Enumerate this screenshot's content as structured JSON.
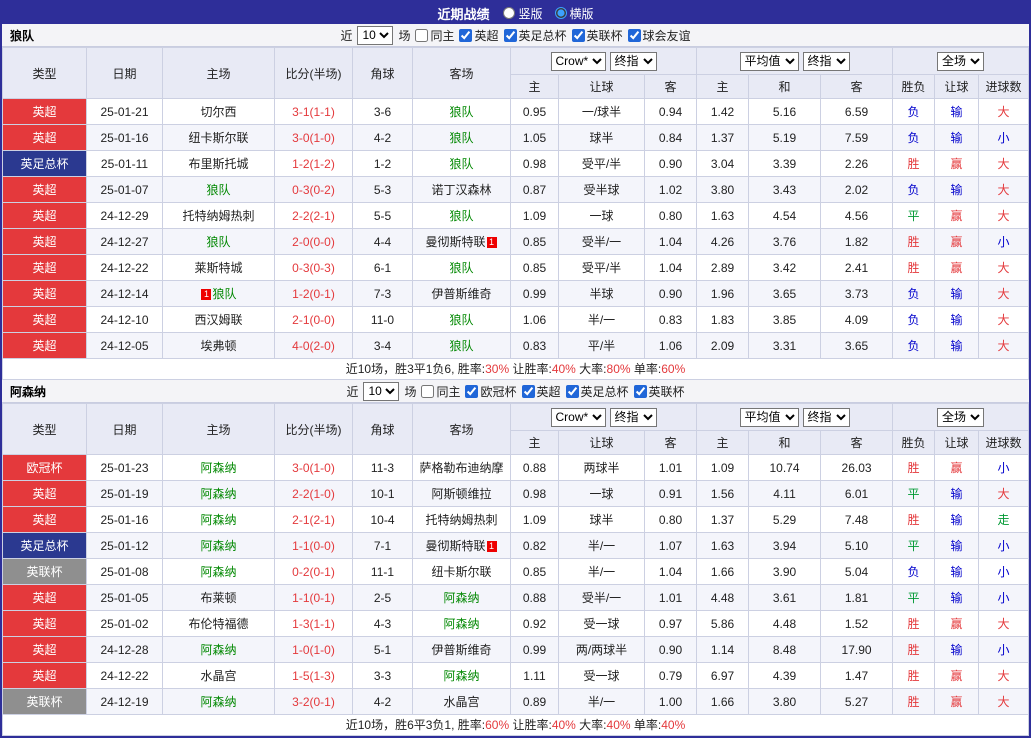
{
  "topbar": {
    "title": "近期战绩",
    "radios": [
      {
        "label": "竖版",
        "selected": false
      },
      {
        "label": "横版",
        "selected": true
      }
    ]
  },
  "colors": {
    "bar": "#2e2e99",
    "subject_team": "#008800",
    "score": "#e4393c",
    "league": {
      "epl": "#e4393c",
      "facup": "#2b3990",
      "eflcup": "#8f8f8f",
      "ucl": "#e4393c"
    },
    "result": {
      "win": "#e4393c",
      "draw": "#009933",
      "lose": "#0000cc",
      "plain": "#222222"
    }
  },
  "filter_labels": {
    "near": "近",
    "games": "场",
    "same_home": "同主"
  },
  "table_header": {
    "type": "类型",
    "date": "日期",
    "home": "主场",
    "score": "比分(半场)",
    "corner": "角球",
    "away": "客场",
    "bookmaker_select": "Crow*",
    "final_select": "终指",
    "average_select": "平均值",
    "fullmatch_select": "全场",
    "sub": [
      "主",
      "让球",
      "客",
      "主",
      "和",
      "客",
      "胜负",
      "让球",
      "进球数"
    ]
  },
  "sections": [
    {
      "team": "狼队",
      "count": "10",
      "same_home_checked": false,
      "leagues": [
        {
          "label": "英超",
          "checked": true
        },
        {
          "label": "英足总杯",
          "checked": true
        },
        {
          "label": "英联杯",
          "checked": true
        },
        {
          "label": "球会友谊",
          "checked": true
        }
      ],
      "rows": [
        {
          "lg": "英超",
          "lk": "epl",
          "date": "25-01-21",
          "home": {
            "n": "切尔西"
          },
          "score": "3-1(1-1)",
          "corner": "3-6",
          "away": {
            "n": "狼队",
            "s": 1
          },
          "asian": [
            "0.95",
            "一/球半",
            "0.94"
          ],
          "euro": [
            "1.42",
            "5.16",
            "6.59"
          ],
          "res": [
            [
              "负",
              "lose"
            ],
            [
              "输",
              "lose"
            ],
            [
              "大",
              "win"
            ]
          ]
        },
        {
          "lg": "英超",
          "lk": "epl",
          "date": "25-01-16",
          "home": {
            "n": "纽卡斯尔联"
          },
          "score": "3-0(1-0)",
          "corner": "4-2",
          "away": {
            "n": "狼队",
            "s": 1
          },
          "asian": [
            "1.05",
            "球半",
            "0.84"
          ],
          "euro": [
            "1.37",
            "5.19",
            "7.59"
          ],
          "res": [
            [
              "负",
              "lose"
            ],
            [
              "输",
              "lose"
            ],
            [
              "小",
              "lose"
            ]
          ]
        },
        {
          "lg": "英足总杯",
          "lk": "facup",
          "date": "25-01-11",
          "home": {
            "n": "布里斯托城"
          },
          "score": "1-2(1-2)",
          "corner": "1-2",
          "away": {
            "n": "狼队",
            "s": 1
          },
          "asian": [
            "0.98",
            "受平/半",
            "0.90"
          ],
          "euro": [
            "3.04",
            "3.39",
            "2.26"
          ],
          "res": [
            [
              "胜",
              "win"
            ],
            [
              "赢",
              "win"
            ],
            [
              "大",
              "win"
            ]
          ]
        },
        {
          "lg": "英超",
          "lk": "epl",
          "date": "25-01-07",
          "home": {
            "n": "狼队",
            "s": 1
          },
          "score": "0-3(0-2)",
          "corner": "5-3",
          "away": {
            "n": "诺丁汉森林"
          },
          "asian": [
            "0.87",
            "受半球",
            "1.02"
          ],
          "euro": [
            "3.80",
            "3.43",
            "2.02"
          ],
          "res": [
            [
              "负",
              "lose"
            ],
            [
              "输",
              "lose"
            ],
            [
              "大",
              "win"
            ]
          ]
        },
        {
          "lg": "英超",
          "lk": "epl",
          "date": "24-12-29",
          "home": {
            "n": "托特纳姆热刺"
          },
          "score": "2-2(2-1)",
          "corner": "5-5",
          "away": {
            "n": "狼队",
            "s": 1
          },
          "asian": [
            "1.09",
            "一球",
            "0.80"
          ],
          "euro": [
            "1.63",
            "4.54",
            "4.56"
          ],
          "res": [
            [
              "平",
              "draw"
            ],
            [
              "赢",
              "win"
            ],
            [
              "大",
              "win"
            ]
          ]
        },
        {
          "lg": "英超",
          "lk": "epl",
          "date": "24-12-27",
          "home": {
            "n": "狼队",
            "s": 1
          },
          "score": "2-0(0-0)",
          "corner": "4-4",
          "away": {
            "n": "曼彻斯特联",
            "b": "1",
            "bp": "after"
          },
          "asian": [
            "0.85",
            "受半/一",
            "1.04"
          ],
          "euro": [
            "4.26",
            "3.76",
            "1.82"
          ],
          "res": [
            [
              "胜",
              "win"
            ],
            [
              "赢",
              "win"
            ],
            [
              "小",
              "lose"
            ]
          ]
        },
        {
          "lg": "英超",
          "lk": "epl",
          "date": "24-12-22",
          "home": {
            "n": "莱斯特城"
          },
          "score": "0-3(0-3)",
          "corner": "6-1",
          "away": {
            "n": "狼队",
            "s": 1
          },
          "asian": [
            "0.85",
            "受平/半",
            "1.04"
          ],
          "euro": [
            "2.89",
            "3.42",
            "2.41"
          ],
          "res": [
            [
              "胜",
              "win"
            ],
            [
              "赢",
              "win"
            ],
            [
              "大",
              "win"
            ]
          ]
        },
        {
          "lg": "英超",
          "lk": "epl",
          "date": "24-12-14",
          "home": {
            "n": "狼队",
            "s": 1,
            "b": "1",
            "bp": "before"
          },
          "score": "1-2(0-1)",
          "corner": "7-3",
          "away": {
            "n": "伊普斯维奇"
          },
          "asian": [
            "0.99",
            "半球",
            "0.90"
          ],
          "euro": [
            "1.96",
            "3.65",
            "3.73"
          ],
          "res": [
            [
              "负",
              "lose"
            ],
            [
              "输",
              "lose"
            ],
            [
              "大",
              "win"
            ]
          ]
        },
        {
          "lg": "英超",
          "lk": "epl",
          "date": "24-12-10",
          "home": {
            "n": "西汉姆联"
          },
          "score": "2-1(0-0)",
          "corner": "11-0",
          "away": {
            "n": "狼队",
            "s": 1
          },
          "asian": [
            "1.06",
            "半/一",
            "0.83"
          ],
          "euro": [
            "1.83",
            "3.85",
            "4.09"
          ],
          "res": [
            [
              "负",
              "lose"
            ],
            [
              "输",
              "lose"
            ],
            [
              "大",
              "win"
            ]
          ]
        },
        {
          "lg": "英超",
          "lk": "epl",
          "date": "24-12-05",
          "home": {
            "n": "埃弗顿"
          },
          "score": "4-0(2-0)",
          "corner": "3-4",
          "away": {
            "n": "狼队",
            "s": 1
          },
          "asian": [
            "0.83",
            "平/半",
            "1.06"
          ],
          "euro": [
            "2.09",
            "3.31",
            "3.65"
          ],
          "res": [
            [
              "负",
              "lose"
            ],
            [
              "输",
              "lose"
            ],
            [
              "大",
              "win"
            ]
          ]
        }
      ],
      "summary": [
        {
          "t": "近10场，胜3平1负6, 胜率:",
          "k": "plain"
        },
        {
          "t": "30%",
          "k": "win"
        },
        {
          "t": " 让胜率:",
          "k": "plain"
        },
        {
          "t": "40%",
          "k": "win"
        },
        {
          "t": " 大率:",
          "k": "plain"
        },
        {
          "t": "80%",
          "k": "win"
        },
        {
          "t": " 单率:",
          "k": "plain"
        },
        {
          "t": "60%",
          "k": "win"
        }
      ]
    },
    {
      "team": "阿森纳",
      "count": "10",
      "same_home_checked": false,
      "leagues": [
        {
          "label": "欧冠杯",
          "checked": true
        },
        {
          "label": "英超",
          "checked": true
        },
        {
          "label": "英足总杯",
          "checked": true
        },
        {
          "label": "英联杯",
          "checked": true
        }
      ],
      "rows": [
        {
          "lg": "欧冠杯",
          "lk": "ucl",
          "date": "25-01-23",
          "home": {
            "n": "阿森纳",
            "s": 1
          },
          "score": "3-0(1-0)",
          "corner": "11-3",
          "away": {
            "n": "萨格勒布迪纳摩"
          },
          "asian": [
            "0.88",
            "两球半",
            "1.01"
          ],
          "euro": [
            "1.09",
            "10.74",
            "26.03"
          ],
          "res": [
            [
              "胜",
              "win"
            ],
            [
              "赢",
              "win"
            ],
            [
              "小",
              "lose"
            ]
          ]
        },
        {
          "lg": "英超",
          "lk": "epl",
          "date": "25-01-19",
          "home": {
            "n": "阿森纳",
            "s": 1
          },
          "score": "2-2(1-0)",
          "corner": "10-1",
          "away": {
            "n": "阿斯顿维拉"
          },
          "asian": [
            "0.98",
            "一球",
            "0.91"
          ],
          "euro": [
            "1.56",
            "4.11",
            "6.01"
          ],
          "res": [
            [
              "平",
              "draw"
            ],
            [
              "输",
              "lose"
            ],
            [
              "大",
              "win"
            ]
          ]
        },
        {
          "lg": "英超",
          "lk": "epl",
          "date": "25-01-16",
          "home": {
            "n": "阿森纳",
            "s": 1
          },
          "score": "2-1(2-1)",
          "corner": "10-4",
          "away": {
            "n": "托特纳姆热刺"
          },
          "asian": [
            "1.09",
            "球半",
            "0.80"
          ],
          "euro": [
            "1.37",
            "5.29",
            "7.48"
          ],
          "res": [
            [
              "胜",
              "win"
            ],
            [
              "输",
              "lose"
            ],
            [
              "走",
              "draw"
            ]
          ]
        },
        {
          "lg": "英足总杯",
          "lk": "facup",
          "date": "25-01-12",
          "home": {
            "n": "阿森纳",
            "s": 1
          },
          "score": "1-1(0-0)",
          "corner": "7-1",
          "away": {
            "n": "曼彻斯特联",
            "b": "1",
            "bp": "after"
          },
          "asian": [
            "0.82",
            "半/一",
            "1.07"
          ],
          "euro": [
            "1.63",
            "3.94",
            "5.10"
          ],
          "res": [
            [
              "平",
              "draw"
            ],
            [
              "输",
              "lose"
            ],
            [
              "小",
              "lose"
            ]
          ]
        },
        {
          "lg": "英联杯",
          "lk": "eflcup",
          "date": "25-01-08",
          "home": {
            "n": "阿森纳",
            "s": 1
          },
          "score": "0-2(0-1)",
          "corner": "11-1",
          "away": {
            "n": "纽卡斯尔联"
          },
          "asian": [
            "0.85",
            "半/一",
            "1.04"
          ],
          "euro": [
            "1.66",
            "3.90",
            "5.04"
          ],
          "res": [
            [
              "负",
              "lose"
            ],
            [
              "输",
              "lose"
            ],
            [
              "小",
              "lose"
            ]
          ]
        },
        {
          "lg": "英超",
          "lk": "epl",
          "date": "25-01-05",
          "home": {
            "n": "布莱顿"
          },
          "score": "1-1(0-1)",
          "corner": "2-5",
          "away": {
            "n": "阿森纳",
            "s": 1
          },
          "asian": [
            "0.88",
            "受半/一",
            "1.01"
          ],
          "euro": [
            "4.48",
            "3.61",
            "1.81"
          ],
          "res": [
            [
              "平",
              "draw"
            ],
            [
              "输",
              "lose"
            ],
            [
              "小",
              "lose"
            ]
          ]
        },
        {
          "lg": "英超",
          "lk": "epl",
          "date": "25-01-02",
          "home": {
            "n": "布伦特福德"
          },
          "score": "1-3(1-1)",
          "corner": "4-3",
          "away": {
            "n": "阿森纳",
            "s": 1
          },
          "asian": [
            "0.92",
            "受一球",
            "0.97"
          ],
          "euro": [
            "5.86",
            "4.48",
            "1.52"
          ],
          "res": [
            [
              "胜",
              "win"
            ],
            [
              "赢",
              "win"
            ],
            [
              "大",
              "win"
            ]
          ]
        },
        {
          "lg": "英超",
          "lk": "epl",
          "date": "24-12-28",
          "home": {
            "n": "阿森纳",
            "s": 1
          },
          "score": "1-0(1-0)",
          "corner": "5-1",
          "away": {
            "n": "伊普斯维奇"
          },
          "asian": [
            "0.99",
            "两/两球半",
            "0.90"
          ],
          "euro": [
            "1.14",
            "8.48",
            "17.90"
          ],
          "res": [
            [
              "胜",
              "win"
            ],
            [
              "输",
              "lose"
            ],
            [
              "小",
              "lose"
            ]
          ]
        },
        {
          "lg": "英超",
          "lk": "epl",
          "date": "24-12-22",
          "home": {
            "n": "水晶宫"
          },
          "score": "1-5(1-3)",
          "corner": "3-3",
          "away": {
            "n": "阿森纳",
            "s": 1
          },
          "asian": [
            "1.11",
            "受一球",
            "0.79"
          ],
          "euro": [
            "6.97",
            "4.39",
            "1.47"
          ],
          "res": [
            [
              "胜",
              "win"
            ],
            [
              "赢",
              "win"
            ],
            [
              "大",
              "win"
            ]
          ]
        },
        {
          "lg": "英联杯",
          "lk": "eflcup",
          "date": "24-12-19",
          "home": {
            "n": "阿森纳",
            "s": 1
          },
          "score": "3-2(0-1)",
          "corner": "4-2",
          "away": {
            "n": "水晶宫"
          },
          "asian": [
            "0.89",
            "半/一",
            "1.00"
          ],
          "euro": [
            "1.66",
            "3.80",
            "5.27"
          ],
          "res": [
            [
              "胜",
              "win"
            ],
            [
              "赢",
              "win"
            ],
            [
              "大",
              "win"
            ]
          ]
        }
      ],
      "summary": [
        {
          "t": "近10场，胜6平3负1, 胜率:",
          "k": "plain"
        },
        {
          "t": "60%",
          "k": "win"
        },
        {
          "t": " 让胜率:",
          "k": "plain"
        },
        {
          "t": "40%",
          "k": "win"
        },
        {
          "t": " 大率:",
          "k": "plain"
        },
        {
          "t": "40%",
          "k": "win"
        },
        {
          "t": " 单率:",
          "k": "plain"
        },
        {
          "t": "40%",
          "k": "win"
        }
      ]
    }
  ]
}
